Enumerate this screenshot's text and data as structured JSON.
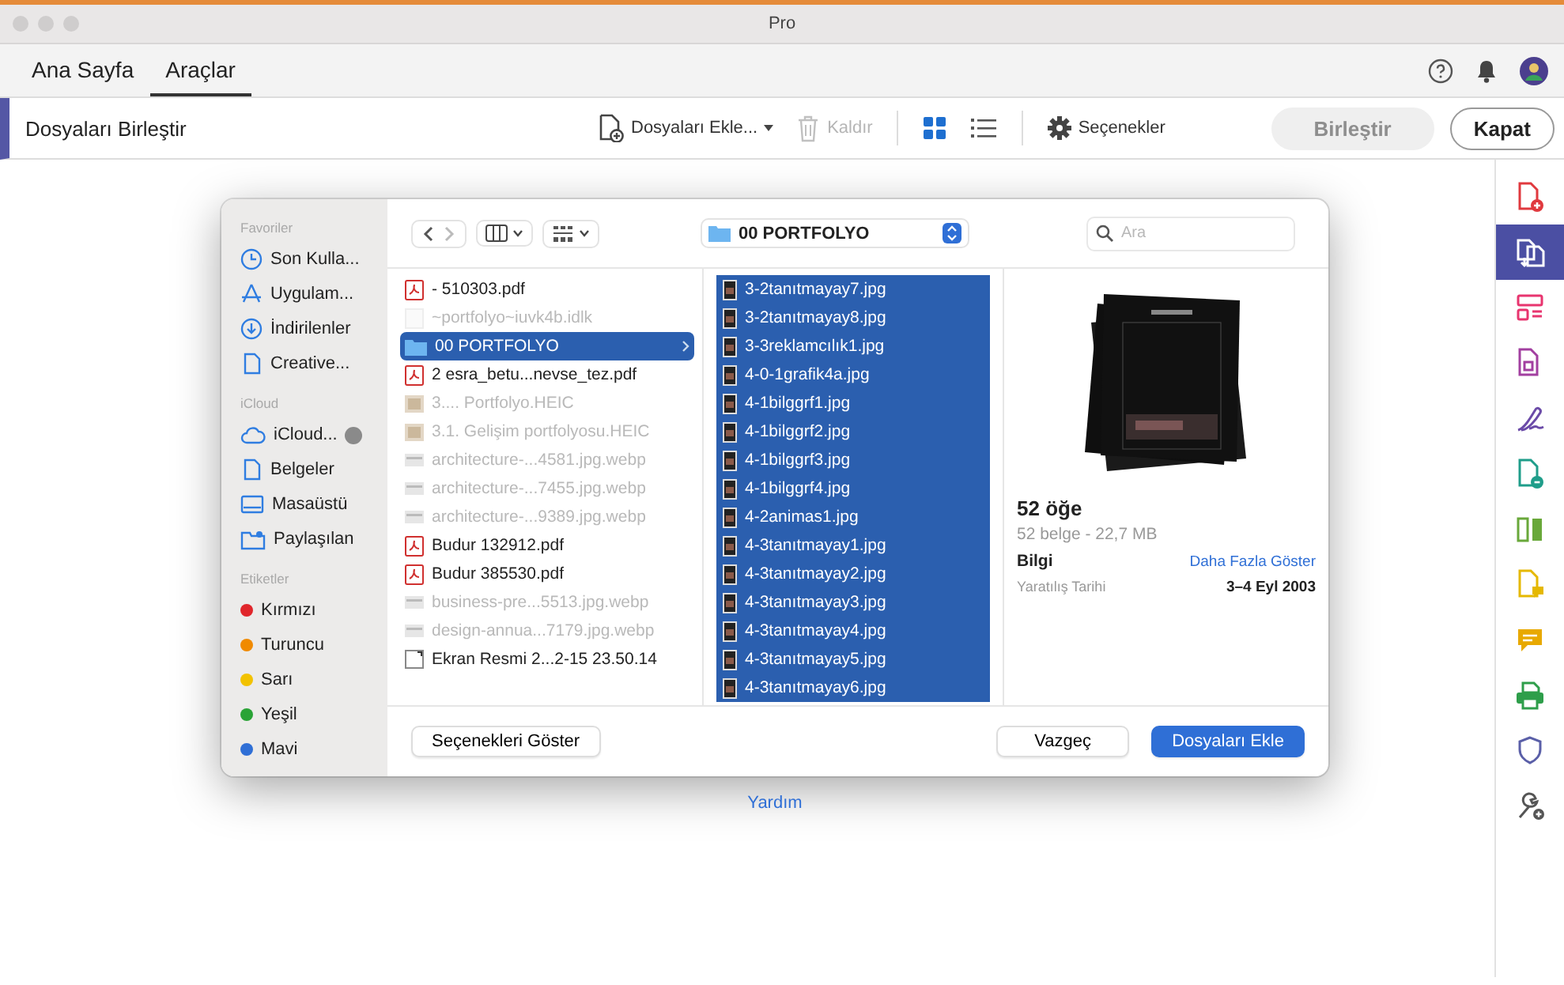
{
  "window": {
    "title": "Pro"
  },
  "tabs": [
    {
      "label": "Ana Sayfa",
      "selected": false
    },
    {
      "label": "Araçlar",
      "selected": true
    }
  ],
  "toolbar": {
    "title": "Dosyaları Birleştir",
    "actions": [
      {
        "kind": "add",
        "label": "Dosyaları Ekle...",
        "disabled": false
      },
      {
        "kind": "remove",
        "label": "Kaldır",
        "disabled": true
      }
    ],
    "views": [
      {
        "kind": "grid",
        "selected": true
      },
      {
        "kind": "list",
        "selected": false
      }
    ],
    "options": "Seçenekler",
    "buttons": [
      {
        "label": "Birleştir",
        "disabled": true
      },
      {
        "label": "Kapat",
        "disabled": false
      }
    ]
  },
  "rail": [
    {
      "kind": "doc-plus",
      "color": "#e0393e",
      "selected": false
    },
    {
      "kind": "docs",
      "color": "#4b4fa3",
      "selected": true
    },
    {
      "kind": "layout",
      "color": "#e8356f",
      "selected": false
    },
    {
      "kind": "doc",
      "color": "#a23fa0",
      "selected": false
    },
    {
      "kind": "pen",
      "color": "#6b4ba8",
      "selected": false
    },
    {
      "kind": "doc-badge",
      "color": "#1f9d8a",
      "selected": false
    },
    {
      "kind": "columns",
      "color": "#69a83a",
      "selected": false
    },
    {
      "kind": "doc-comment",
      "color": "#e5b800",
      "selected": false
    },
    {
      "kind": "comment",
      "color": "#e8a900",
      "selected": false
    },
    {
      "kind": "printer",
      "color": "#2e9e4a",
      "selected": false
    },
    {
      "kind": "shield",
      "color": "#5a5fa8",
      "selected": false
    },
    {
      "kind": "wrench",
      "color": "#555555",
      "selected": false
    }
  ],
  "dialog": {
    "sidebar": [
      {
        "heading": "Favoriler",
        "items": [
          {
            "kind": "clock",
            "label": "Son Kulla..."
          },
          {
            "kind": "apps",
            "label": "Uygulam..."
          },
          {
            "kind": "download",
            "label": "İndirilenler"
          },
          {
            "kind": "doc",
            "label": "Creative..."
          }
        ]
      },
      {
        "heading": "iCloud",
        "items": [
          {
            "kind": "cloud",
            "label": "iCloud..."
          },
          {
            "kind": "doc",
            "label": "Belgeler"
          },
          {
            "kind": "desktop",
            "label": "Masaüstü"
          },
          {
            "kind": "shared",
            "label": "Paylaşılan"
          }
        ]
      },
      {
        "heading": "Etiketler",
        "items": [
          {
            "kind": "tag",
            "label": "Kırmızı",
            "color": "#e0262b"
          },
          {
            "kind": "tag",
            "label": "Turuncu",
            "color": "#f08a00"
          },
          {
            "kind": "tag",
            "label": "Sarı",
            "color": "#f2c200"
          },
          {
            "kind": "tag",
            "label": "Yeşil",
            "color": "#2aa336"
          },
          {
            "kind": "tag",
            "label": "Mavi",
            "color": "#2f6fd6"
          }
        ]
      }
    ],
    "path": "00 PORTFOLYO",
    "search": {
      "placeholder": "Ara"
    },
    "column_1": [
      {
        "kind": "pdf",
        "name": "- 510303.pdf",
        "dimmed": false,
        "selected": false
      },
      {
        "kind": "blank",
        "name": "~portfolyo~iuvk4b.idlk",
        "dimmed": true,
        "selected": false
      },
      {
        "kind": "folder",
        "name": "00 PORTFOLYO",
        "dimmed": false,
        "selected": true
      },
      {
        "kind": "pdf",
        "name": "2    esra_betu...nevse_tez.pdf",
        "dimmed": false,
        "selected": false
      },
      {
        "kind": "image",
        "name": "3.... Portfolyo.HEIC",
        "dimmed": true,
        "selected": false
      },
      {
        "kind": "image",
        "name": "3.1. Gelişim portfolyosu.HEIC",
        "dimmed": true,
        "selected": false
      },
      {
        "kind": "web",
        "name": "architecture-...4581.jpg.webp",
        "dimmed": true,
        "selected": false
      },
      {
        "kind": "web",
        "name": "architecture-...7455.jpg.webp",
        "dimmed": true,
        "selected": false
      },
      {
        "kind": "web",
        "name": "architecture-...9389.jpg.webp",
        "dimmed": true,
        "selected": false
      },
      {
        "kind": "pdf",
        "name": "Budur 132912.pdf",
        "dimmed": false,
        "selected": false
      },
      {
        "kind": "pdf",
        "name": "Budur 385530.pdf",
        "dimmed": false,
        "selected": false
      },
      {
        "kind": "web",
        "name": "business-pre...5513.jpg.webp",
        "dimmed": true,
        "selected": false
      },
      {
        "kind": "web",
        "name": "design-annua...7179.jpg.webp",
        "dimmed": true,
        "selected": false
      },
      {
        "kind": "screenshot",
        "name": "Ekran Resmi 2...2-15 23.50.14",
        "dimmed": false,
        "selected": false
      }
    ],
    "column_2": [
      {
        "name": "3-2tanıtmayay7.jpg",
        "selected": true
      },
      {
        "name": "3-2tanıtmayay8.jpg",
        "selected": true
      },
      {
        "name": "3-3reklamcılık1.jpg",
        "selected": true
      },
      {
        "name": "4-0-1grafik4a.jpg",
        "selected": true
      },
      {
        "name": "4-1bilggrf1.jpg",
        "selected": true
      },
      {
        "name": "4-1bilggrf2.jpg",
        "selected": true
      },
      {
        "name": "4-1bilggrf3.jpg",
        "selected": true
      },
      {
        "name": "4-1bilggrf4.jpg",
        "selected": true
      },
      {
        "name": "4-2animas1.jpg",
        "selected": true
      },
      {
        "name": "4-3tanıtmayay1.jpg",
        "selected": true
      },
      {
        "name": "4-3tanıtmayay2.jpg",
        "selected": true
      },
      {
        "name": "4-3tanıtmayay3.jpg",
        "selected": true
      },
      {
        "name": "4-3tanıtmayay4.jpg",
        "selected": true
      },
      {
        "name": "4-3tanıtmayay5.jpg",
        "selected": true
      },
      {
        "name": "4-3tanıtmayay6.jpg",
        "selected": true
      }
    ],
    "preview": {
      "count": "52 öğe",
      "summary": "52 belge - 22,7 MB",
      "info_heading": "Bilgi",
      "more_link": "Daha Fazla Göster",
      "rows": [
        {
          "label": "Yaratılış Tarihi",
          "value": "3–4 Eyl 2003"
        }
      ]
    },
    "buttons": [
      {
        "kind": "secondary",
        "label": "Seçenekleri Göster"
      },
      {
        "kind": "secondary",
        "label": "Vazgeç"
      },
      {
        "kind": "primary",
        "label": "Dosyaları Ekle"
      }
    ]
  },
  "help_link": "Yardım"
}
